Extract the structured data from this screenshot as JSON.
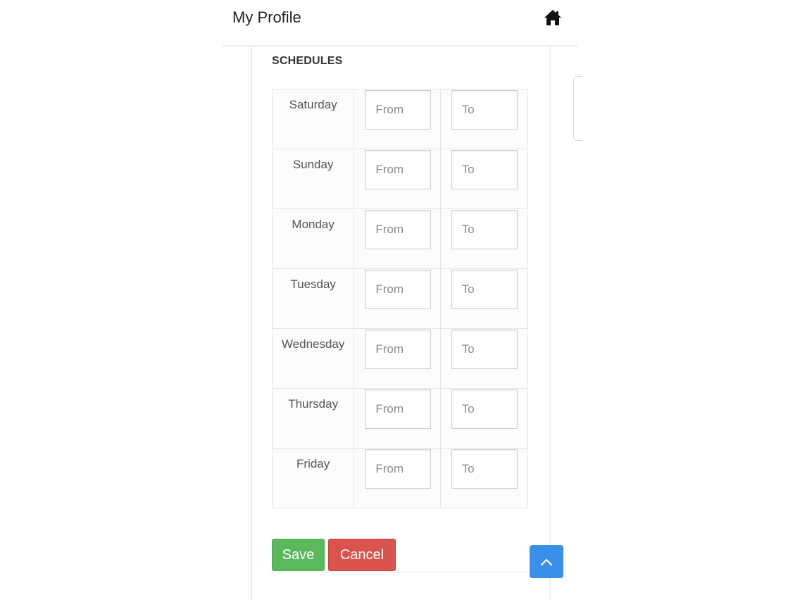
{
  "header": {
    "title": "My Profile",
    "home_icon": "home-icon"
  },
  "schedules": {
    "title": "SCHEDULES",
    "from_placeholder": "From",
    "to_placeholder": "To",
    "days": [
      {
        "day": "Saturday",
        "from": "",
        "to": ""
      },
      {
        "day": "Sunday",
        "from": "",
        "to": ""
      },
      {
        "day": "Monday",
        "from": "",
        "to": ""
      },
      {
        "day": "Tuesday",
        "from": "",
        "to": ""
      },
      {
        "day": "Wednesday",
        "from": "",
        "to": ""
      },
      {
        "day": "Thursday",
        "from": "",
        "to": ""
      },
      {
        "day": "Friday",
        "from": "",
        "to": ""
      }
    ]
  },
  "actions": {
    "save_label": "Save",
    "cancel_label": "Cancel",
    "scroll_top_icon": "chevron-up-icon"
  },
  "colors": {
    "save": "#5cb85c",
    "cancel": "#d9534f",
    "scroll_top": "#3a8fe8"
  }
}
